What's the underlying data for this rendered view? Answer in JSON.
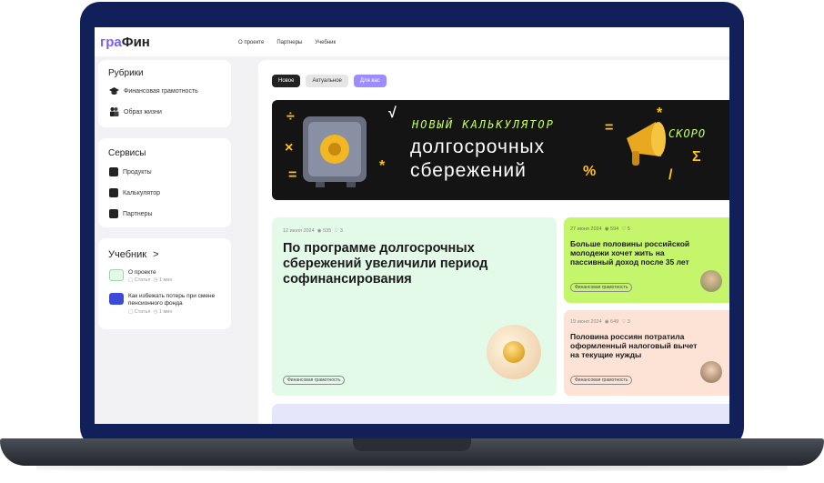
{
  "header": {
    "logo_prefix": "гра",
    "logo_suffix": "Фин",
    "nav": [
      "О проекте",
      "Партнеры",
      "Учебник"
    ]
  },
  "sidebar": {
    "rubrics": {
      "title": "Рубрики",
      "items": [
        {
          "label": "Финансовая грамотность",
          "icon": "graduation-cap-icon"
        },
        {
          "label": "Образ жизни",
          "icon": "people-icon"
        }
      ]
    },
    "services": {
      "title": "Сервисы",
      "items": [
        {
          "label": "Продукты",
          "icon": "briefcase-icon"
        },
        {
          "label": "Калькулятор",
          "icon": "calculator-icon"
        },
        {
          "label": "Партнеры",
          "icon": "chart-icon"
        }
      ]
    },
    "tutorial": {
      "title": "Учебник",
      "arrow": ">",
      "items": [
        {
          "title": "О проекте",
          "type": "Статья",
          "time": "1 мин"
        },
        {
          "title": "Как избежать потерь при смене пенсионного фонда",
          "type": "Статья",
          "time": "1 мин"
        }
      ]
    }
  },
  "filters": [
    "Новое",
    "Актуальное",
    "Для вас"
  ],
  "banner": {
    "line1": "НОВЫЙ КАЛЬКУЛЯТОР",
    "line2": "долгосрочных",
    "line3": "сбережений",
    "badge": "СКОРО"
  },
  "articles": [
    {
      "date": "12 июля 2024",
      "views": "535",
      "likes": "3",
      "title": "По программе долгосрочных сбережений увеличили период софинансирования",
      "tag": "Финансовая грамотность",
      "bg": "#e3fae8"
    },
    {
      "date": "27 июня 2024",
      "views": "594",
      "likes": "5",
      "title": "Больше половины российской молодежи хочет жить на пассивный доход после 35 лет",
      "tag": "Финансовая грамотность",
      "bg": "#c5f56a"
    },
    {
      "date": "19 июня 2024",
      "views": "649",
      "likes": "3",
      "title": "Половина россиян потратила оформленный налоговый вычет на текущие нужды",
      "tag": "Финансовая грамотность",
      "bg": "#fde3d6"
    }
  ],
  "colors": {
    "accent": "#7c5cff",
    "frame": "#12205a",
    "banner_green": "#c8ff5a"
  }
}
